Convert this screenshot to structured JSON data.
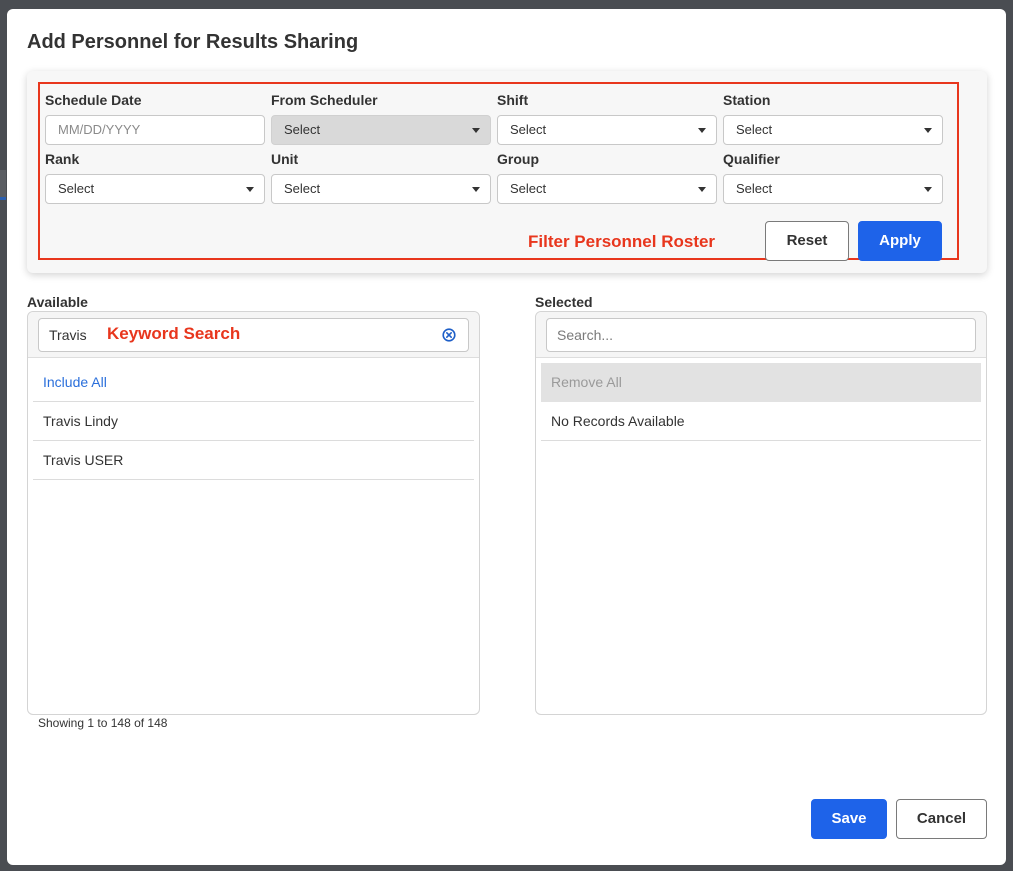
{
  "modal": {
    "title": "Add Personnel for Results Sharing"
  },
  "filter": {
    "annotation": "Filter Personnel Roster",
    "fields": {
      "schedule_date": {
        "label": "Schedule Date",
        "placeholder": "MM/DD/YYYY"
      },
      "from_scheduler": {
        "label": "From Scheduler",
        "value": "Select",
        "disabled": true
      },
      "shift": {
        "label": "Shift",
        "value": "Select"
      },
      "station": {
        "label": "Station",
        "value": "Select"
      },
      "rank": {
        "label": "Rank",
        "value": "Select"
      },
      "unit": {
        "label": "Unit",
        "value": "Select"
      },
      "group": {
        "label": "Group",
        "value": "Select"
      },
      "qualifier": {
        "label": "Qualifier",
        "value": "Select"
      }
    },
    "reset_label": "Reset",
    "apply_label": "Apply"
  },
  "available": {
    "label": "Available",
    "search_value": "Travis",
    "annotation": "Keyword Search",
    "include_all": "Include All",
    "items": [
      "Travis Lindy",
      "Travis USER"
    ],
    "showing": "Showing 1 to 148 of 148"
  },
  "selected": {
    "label": "Selected",
    "search_placeholder": "Search...",
    "remove_all": "Remove All",
    "empty": "No Records Available"
  },
  "footer": {
    "save_label": "Save",
    "cancel_label": "Cancel"
  },
  "colors": {
    "primary": "#1e63e9",
    "annotation": "#e8361d",
    "link": "#2a6fdb"
  }
}
